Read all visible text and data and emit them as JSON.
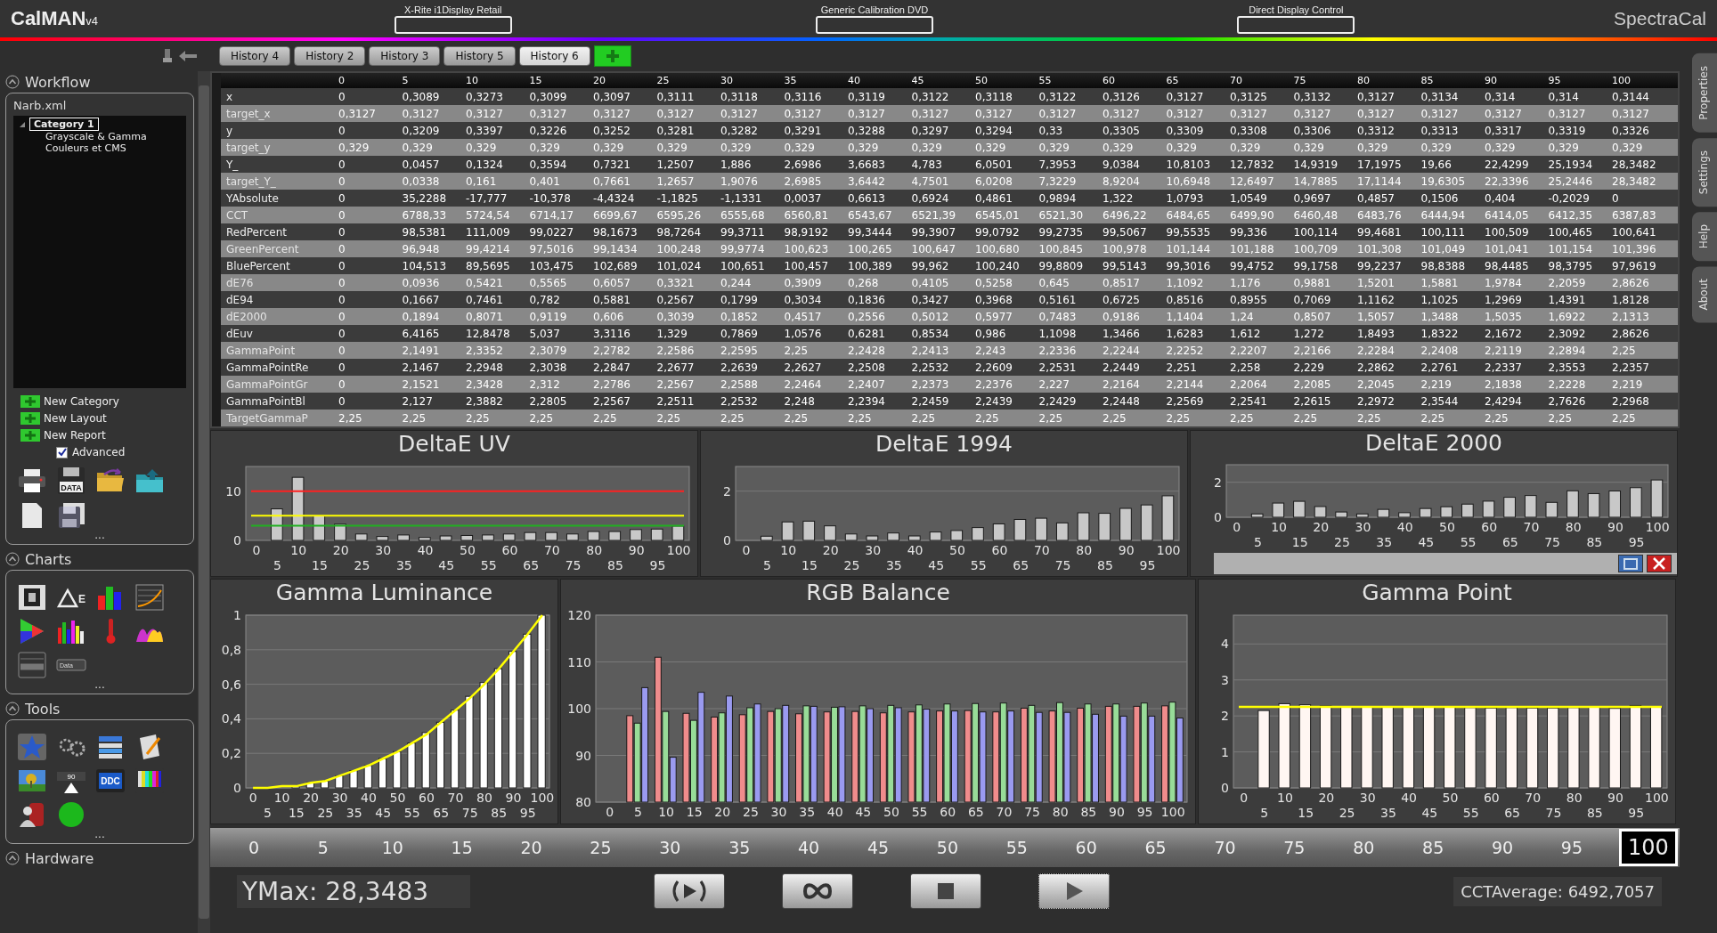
{
  "header": {
    "logo": "CalMAN",
    "logo_version": "v4",
    "devices": [
      {
        "label": "X-Rite i1Display Retail"
      },
      {
        "label": "Generic Calibration DVD"
      },
      {
        "label": "Direct Display Control"
      }
    ],
    "brand": "SpectraCal"
  },
  "history_tabs": [
    {
      "label": "History 4",
      "selected": false
    },
    {
      "label": "History 2",
      "selected": false
    },
    {
      "label": "History 3",
      "selected": false
    },
    {
      "label": "History 5",
      "selected": false
    },
    {
      "label": "History 6",
      "selected": true
    }
  ],
  "sidebar": {
    "workflow": {
      "title": "Workflow",
      "file": "Narb.xml",
      "tree": [
        {
          "label": "Category 1",
          "selected": true,
          "expanded": true,
          "children": [
            {
              "label": "Grayscale & Gamma",
              "selected": false
            },
            {
              "label": "Couleurs et CMS",
              "selected": false
            }
          ]
        }
      ],
      "actions": [
        "New Category",
        "New Layout",
        "New Report"
      ],
      "advanced": {
        "label": "Advanced",
        "checked": true
      },
      "icon_labels": [
        "DATA"
      ],
      "more": "..."
    },
    "charts": {
      "title": "Charts",
      "icon_labels": [
        "E",
        "Data"
      ],
      "more": "..."
    },
    "tools": {
      "title": "Tools",
      "icon_labels": [
        "90",
        "DDC"
      ],
      "more": "..."
    },
    "hardware": {
      "title": "Hardware"
    }
  },
  "side_tabs": [
    "Properties",
    "Settings",
    "Help",
    "About"
  ],
  "table": {
    "columns": [
      "0",
      "5",
      "10",
      "15",
      "20",
      "25",
      "30",
      "35",
      "40",
      "45",
      "50",
      "55",
      "60",
      "65",
      "70",
      "75",
      "80",
      "85",
      "90",
      "95",
      "100"
    ],
    "rows": [
      {
        "label": "x",
        "cells": [
          "0",
          "0,3089",
          "0,3273",
          "0,3099",
          "0,3097",
          "0,3111",
          "0,3118",
          "0,3116",
          "0,3119",
          "0,3122",
          "0,3118",
          "0,3122",
          "0,3126",
          "0,3127",
          "0,3125",
          "0,3132",
          "0,3127",
          "0,3134",
          "0,314",
          "0,314",
          "0,3144"
        ]
      },
      {
        "label": "target_x",
        "cells": [
          "0,3127",
          "0,3127",
          "0,3127",
          "0,3127",
          "0,3127",
          "0,3127",
          "0,3127",
          "0,3127",
          "0,3127",
          "0,3127",
          "0,3127",
          "0,3127",
          "0,3127",
          "0,3127",
          "0,3127",
          "0,3127",
          "0,3127",
          "0,3127",
          "0,3127",
          "0,3127",
          "0,3127"
        ]
      },
      {
        "label": "y",
        "cells": [
          "0",
          "0,3209",
          "0,3397",
          "0,3226",
          "0,3252",
          "0,3281",
          "0,3282",
          "0,3291",
          "0,3288",
          "0,3297",
          "0,3294",
          "0,33",
          "0,3305",
          "0,3309",
          "0,3308",
          "0,3306",
          "0,3312",
          "0,3313",
          "0,3317",
          "0,3319",
          "0,3326"
        ]
      },
      {
        "label": "target_y",
        "cells": [
          "0,329",
          "0,329",
          "0,329",
          "0,329",
          "0,329",
          "0,329",
          "0,329",
          "0,329",
          "0,329",
          "0,329",
          "0,329",
          "0,329",
          "0,329",
          "0,329",
          "0,329",
          "0,329",
          "0,329",
          "0,329",
          "0,329",
          "0,329",
          "0,329"
        ]
      },
      {
        "label": "Y_",
        "cells": [
          "0",
          "0,0457",
          "0,1324",
          "0,3594",
          "0,7321",
          "1,2507",
          "1,886",
          "2,6986",
          "3,6683",
          "4,783",
          "6,0501",
          "7,3953",
          "9,0384",
          "10,8103",
          "12,7832",
          "14,9319",
          "17,1975",
          "19,66",
          "22,4299",
          "25,1934",
          "28,3482"
        ]
      },
      {
        "label": "target_Y_",
        "cells": [
          "0",
          "0,0338",
          "0,161",
          "0,401",
          "0,7661",
          "1,2657",
          "1,9076",
          "2,6985",
          "3,6442",
          "4,7501",
          "6,0208",
          "7,3229",
          "8,9204",
          "10,6948",
          "12,6497",
          "14,7885",
          "17,1144",
          "19,6305",
          "22,3396",
          "25,2446",
          "28,3482"
        ]
      },
      {
        "label": "YAbsolute",
        "cells": [
          "0",
          "35,2288",
          "-17,777",
          "-10,378",
          "-4,4324",
          "-1,1825",
          "-1,1331",
          "0,0037",
          "0,6613",
          "0,6924",
          "0,4861",
          "0,9894",
          "1,322",
          "1,0793",
          "1,0549",
          "0,9697",
          "0,4857",
          "0,1506",
          "0,404",
          "-0,2029",
          "0"
        ]
      },
      {
        "label": "CCT",
        "cells": [
          "0",
          "6788,33",
          "5724,54",
          "6714,17",
          "6699,67",
          "6595,26",
          "6555,68",
          "6560,81",
          "6543,67",
          "6521,39",
          "6545,01",
          "6521,30",
          "6496,22",
          "6484,65",
          "6499,90",
          "6460,48",
          "6483,76",
          "6444,94",
          "6414,05",
          "6412,35",
          "6387,83"
        ]
      },
      {
        "label": "RedPercent",
        "cells": [
          "0",
          "98,5381",
          "111,009",
          "99,0227",
          "98,1673",
          "98,7264",
          "99,3711",
          "98,9192",
          "99,3444",
          "99,3907",
          "99,0792",
          "99,2735",
          "99,5067",
          "99,5535",
          "99,336",
          "100,114",
          "99,4681",
          "100,111",
          "100,509",
          "100,465",
          "100,641"
        ]
      },
      {
        "label": "GreenPercent",
        "cells": [
          "0",
          "96,948",
          "99,4214",
          "97,5016",
          "99,1434",
          "100,248",
          "99,9774",
          "100,623",
          "100,265",
          "100,647",
          "100,680",
          "100,845",
          "100,978",
          "101,144",
          "101,188",
          "100,709",
          "101,308",
          "101,049",
          "101,041",
          "101,154",
          "101,396"
        ]
      },
      {
        "label": "BluePercent",
        "cells": [
          "0",
          "104,513",
          "89,5695",
          "103,475",
          "102,689",
          "101,024",
          "100,651",
          "100,457",
          "100,389",
          "99,962",
          "100,240",
          "99,8809",
          "99,5143",
          "99,3016",
          "99,4752",
          "99,1758",
          "99,2237",
          "98,8388",
          "98,4485",
          "98,3795",
          "97,9619"
        ]
      },
      {
        "label": "dE76",
        "cells": [
          "0",
          "0,0936",
          "0,5421",
          "0,5565",
          "0,6057",
          "0,3321",
          "0,244",
          "0,3909",
          "0,268",
          "0,4105",
          "0,5258",
          "0,645",
          "0,8517",
          "1,1092",
          "1,176",
          "0,9881",
          "1,5201",
          "1,5881",
          "1,9784",
          "2,2059",
          "2,8626"
        ]
      },
      {
        "label": "dE94",
        "cells": [
          "0",
          "0,1667",
          "0,7461",
          "0,782",
          "0,5881",
          "0,2567",
          "0,1799",
          "0,3034",
          "0,1836",
          "0,3427",
          "0,3968",
          "0,5161",
          "0,6725",
          "0,8516",
          "0,8955",
          "0,7069",
          "1,1162",
          "1,1025",
          "1,2969",
          "1,4391",
          "1,8128"
        ]
      },
      {
        "label": "dE2000",
        "cells": [
          "0",
          "0,1894",
          "0,8071",
          "0,9119",
          "0,606",
          "0,3039",
          "0,1852",
          "0,4517",
          "0,2556",
          "0,5012",
          "0,5977",
          "0,7483",
          "0,9186",
          "1,1404",
          "1,24",
          "0,8507",
          "1,5057",
          "1,3488",
          "1,5035",
          "1,6922",
          "2,1313"
        ]
      },
      {
        "label": "dEuv",
        "cells": [
          "0",
          "6,4165",
          "12,8478",
          "5,037",
          "3,3116",
          "1,329",
          "0,7869",
          "1,0576",
          "0,6281",
          "0,8534",
          "0,986",
          "1,1098",
          "1,3466",
          "1,6283",
          "1,612",
          "1,272",
          "1,8493",
          "1,8322",
          "2,1672",
          "2,3092",
          "2,8626"
        ]
      },
      {
        "label": "GammaPoint",
        "cells": [
          "0",
          "2,1491",
          "2,3352",
          "2,3079",
          "2,2782",
          "2,2586",
          "2,2595",
          "2,25",
          "2,2428",
          "2,2413",
          "2,243",
          "2,2336",
          "2,2244",
          "2,2252",
          "2,2207",
          "2,2166",
          "2,2284",
          "2,2408",
          "2,2119",
          "2,2894",
          "2,25"
        ]
      },
      {
        "label": "GammaPointRe",
        "cells": [
          "0",
          "2,1467",
          "2,2948",
          "2,3038",
          "2,2847",
          "2,2677",
          "2,2639",
          "2,2627",
          "2,2508",
          "2,2532",
          "2,2609",
          "2,2531",
          "2,2449",
          "2,251",
          "2,258",
          "2,229",
          "2,2862",
          "2,2761",
          "2,2337",
          "2,3553",
          "2,2357"
        ]
      },
      {
        "label": "GammaPointGr",
        "cells": [
          "0",
          "2,1521",
          "2,3428",
          "2,312",
          "2,2786",
          "2,2567",
          "2,2588",
          "2,2464",
          "2,2407",
          "2,2373",
          "2,2376",
          "2,227",
          "2,2164",
          "2,2144",
          "2,2064",
          "2,2085",
          "2,2045",
          "2,219",
          "2,1838",
          "2,2228",
          "2,219"
        ]
      },
      {
        "label": "GammaPointBl",
        "cells": [
          "0",
          "2,127",
          "2,3882",
          "2,2805",
          "2,2567",
          "2,2511",
          "2,2532",
          "2,248",
          "2,2394",
          "2,2459",
          "2,2439",
          "2,2429",
          "2,2448",
          "2,2569",
          "2,2541",
          "2,2615",
          "2,2972",
          "2,3544",
          "2,4294",
          "2,7626",
          "2,2968"
        ]
      },
      {
        "label": "TargetGammaP",
        "cells": [
          "2,25",
          "2,25",
          "2,25",
          "2,25",
          "2,25",
          "2,25",
          "2,25",
          "2,25",
          "2,25",
          "2,25",
          "2,25",
          "2,25",
          "2,25",
          "2,25",
          "2,25",
          "2,25",
          "2,25",
          "2,25",
          "2,25",
          "2,25",
          "2,25"
        ]
      }
    ]
  },
  "charts": [
    {
      "chart_data": {
        "type": "bar",
        "title": "DeltaE UV",
        "categories": [
          "0",
          "5",
          "10",
          "15",
          "20",
          "25",
          "30",
          "35",
          "40",
          "45",
          "50",
          "55",
          "60",
          "65",
          "70",
          "75",
          "80",
          "85",
          "90",
          "95",
          "100"
        ],
        "ylim": [
          0,
          15
        ],
        "yticks": [
          0,
          10
        ],
        "series": [
          {
            "color": "#c8c8c8",
            "values": [
              0,
              6.4,
              12.8,
              5,
              3.3,
              1.3,
              0.8,
              1.1,
              0.6,
              0.9,
              1,
              1.1,
              1.3,
              1.6,
              1.6,
              1.3,
              1.8,
              1.8,
              2.2,
              2.3,
              2.9
            ]
          }
        ],
        "ref_lines": [
          {
            "axis": "y",
            "value": 10,
            "color": "#ff2020"
          },
          {
            "axis": "y",
            "value": 5,
            "color": "#ffff00"
          },
          {
            "axis": "y",
            "value": 3,
            "color": "#20b020"
          }
        ]
      }
    },
    {
      "chart_data": {
        "type": "bar",
        "title": "DeltaE 1994",
        "categories": [
          "0",
          "5",
          "10",
          "15",
          "20",
          "25",
          "30",
          "35",
          "40",
          "45",
          "50",
          "55",
          "60",
          "65",
          "70",
          "75",
          "80",
          "85",
          "90",
          "95",
          "100"
        ],
        "ylim": [
          0,
          3
        ],
        "yticks": [
          0,
          2
        ],
        "grid": true,
        "series": [
          {
            "color": "#c8c8c8",
            "values": [
              0,
              0.17,
              0.75,
              0.78,
              0.59,
              0.26,
              0.18,
              0.3,
              0.18,
              0.34,
              0.4,
              0.52,
              0.67,
              0.85,
              0.9,
              0.71,
              1.12,
              1.1,
              1.3,
              1.44,
              1.81
            ]
          }
        ]
      }
    },
    {
      "chart_data": {
        "type": "bar",
        "title": "DeltaE 2000",
        "categories": [
          "0",
          "5",
          "10",
          "15",
          "20",
          "25",
          "30",
          "35",
          "40",
          "45",
          "50",
          "55",
          "60",
          "65",
          "70",
          "75",
          "80",
          "85",
          "90",
          "95",
          "100"
        ],
        "ylim": [
          0,
          3
        ],
        "yticks": [
          0,
          2
        ],
        "grid": true,
        "series": [
          {
            "color": "#c8c8c8",
            "values": [
              0,
              0.19,
              0.81,
              0.91,
              0.61,
              0.3,
              0.19,
              0.45,
              0.26,
              0.5,
              0.6,
              0.75,
              0.92,
              1.14,
              1.24,
              0.85,
              1.51,
              1.35,
              1.5,
              1.69,
              2.13
            ]
          }
        ]
      }
    },
    {
      "chart_data": {
        "type": "bar",
        "title": "Gamma Luminance",
        "categories": [
          "0",
          "5",
          "10",
          "15",
          "20",
          "25",
          "30",
          "35",
          "40",
          "45",
          "50",
          "55",
          "60",
          "65",
          "70",
          "75",
          "80",
          "85",
          "90",
          "95",
          "100"
        ],
        "ylim": [
          0,
          1
        ],
        "yticks": [
          {
            "value": 0,
            "label": "0"
          },
          {
            "value": 0.2,
            "label": "0,2"
          },
          {
            "value": 0.4,
            "label": "0,4"
          },
          {
            "value": 0.6,
            "label": "0,6"
          },
          {
            "value": 0.8,
            "label": "0,8"
          },
          {
            "value": 1,
            "label": "1"
          }
        ],
        "grid": true,
        "series": [
          {
            "color": "#ffffff",
            "values": [
              0,
              0,
              0,
              0.01,
              0.03,
              0.04,
              0.07,
              0.1,
              0.13,
              0.17,
              0.21,
              0.26,
              0.32,
              0.38,
              0.45,
              0.53,
              0.61,
              0.69,
              0.79,
              0.89,
              1
            ]
          },
          {
            "type": "line",
            "color": "#ffff00",
            "values": [
              0,
              0,
              0.01,
              0.01,
              0.03,
              0.04,
              0.07,
              0.1,
              0.13,
              0.17,
              0.21,
              0.26,
              0.31,
              0.38,
              0.45,
              0.52,
              0.6,
              0.69,
              0.79,
              0.89,
              1
            ]
          }
        ]
      }
    },
    {
      "chart_data": {
        "type": "bar",
        "title": "RGB Balance",
        "categories": [
          "0",
          "5",
          "10",
          "15",
          "20",
          "25",
          "30",
          "35",
          "40",
          "45",
          "50",
          "55",
          "60",
          "65",
          "70",
          "75",
          "80",
          "85",
          "90",
          "95",
          "100"
        ],
        "ylim": [
          80,
          120
        ],
        "yticks": [
          80,
          90,
          100,
          110,
          120
        ],
        "grid": true,
        "series": [
          {
            "color": "#f08c8c",
            "values": [
              null,
              98.5,
              111,
              99,
              98.2,
              98.7,
              99.4,
              98.9,
              99.3,
              99.4,
              99.1,
              99.3,
              99.5,
              99.6,
              99.3,
              100.1,
              99.5,
              100.1,
              100.5,
              100.5,
              100.6
            ]
          },
          {
            "color": "#98dc98",
            "values": [
              null,
              96.9,
              99.4,
              97.5,
              99.1,
              100.2,
              100,
              100.6,
              100.3,
              100.6,
              100.7,
              100.8,
              101,
              101.1,
              101.2,
              100.7,
              101.3,
              101,
              101,
              101.2,
              101.4
            ]
          },
          {
            "color": "#9a9af0",
            "values": [
              null,
              104.5,
              89.6,
              103.5,
              102.7,
              101,
              100.7,
              100.5,
              100.4,
              100,
              100.2,
              99.9,
              99.5,
              99.3,
              99.5,
              99.2,
              99.2,
              98.8,
              98.4,
              98.4,
              98
            ]
          }
        ]
      }
    },
    {
      "chart_data": {
        "type": "bar",
        "title": "Gamma Point",
        "categories": [
          "0",
          "5",
          "10",
          "15",
          "20",
          "25",
          "30",
          "35",
          "40",
          "45",
          "50",
          "55",
          "60",
          "65",
          "70",
          "75",
          "80",
          "85",
          "90",
          "95",
          "100"
        ],
        "ylim": [
          0,
          4.8
        ],
        "yticks": [
          0,
          1,
          2,
          3,
          4
        ],
        "grid": true,
        "series": [
          {
            "color": "#fff6f2",
            "values": [
              null,
              2.15,
              2.34,
              2.31,
              2.28,
              2.26,
              2.26,
              2.25,
              2.24,
              2.24,
              2.24,
              2.23,
              2.22,
              2.23,
              2.22,
              2.22,
              2.23,
              2.24,
              2.21,
              2.29,
              2.25
            ]
          }
        ],
        "ref_lines": [
          {
            "axis": "y",
            "value": 2.25,
            "color": "#ffff00"
          }
        ]
      }
    }
  ],
  "slider": {
    "stops": [
      {
        "label": "0",
        "selected": false
      },
      {
        "label": "5",
        "selected": false
      },
      {
        "label": "10",
        "selected": false
      },
      {
        "label": "15",
        "selected": false
      },
      {
        "label": "20",
        "selected": false
      },
      {
        "label": "25",
        "selected": false
      },
      {
        "label": "30",
        "selected": false
      },
      {
        "label": "35",
        "selected": false
      },
      {
        "label": "40",
        "selected": false
      },
      {
        "label": "45",
        "selected": false
      },
      {
        "label": "50",
        "selected": false
      },
      {
        "label": "55",
        "selected": false
      },
      {
        "label": "60",
        "selected": false
      },
      {
        "label": "65",
        "selected": false
      },
      {
        "label": "70",
        "selected": false
      },
      {
        "label": "75",
        "selected": false
      },
      {
        "label": "80",
        "selected": false
      },
      {
        "label": "85",
        "selected": false
      },
      {
        "label": "90",
        "selected": false
      },
      {
        "label": "95",
        "selected": false
      },
      {
        "label": "100",
        "selected": true
      }
    ]
  },
  "status": {
    "ymax": "YMax: 28,3483",
    "cct_average": "CCTAverage: 6492,7057"
  }
}
